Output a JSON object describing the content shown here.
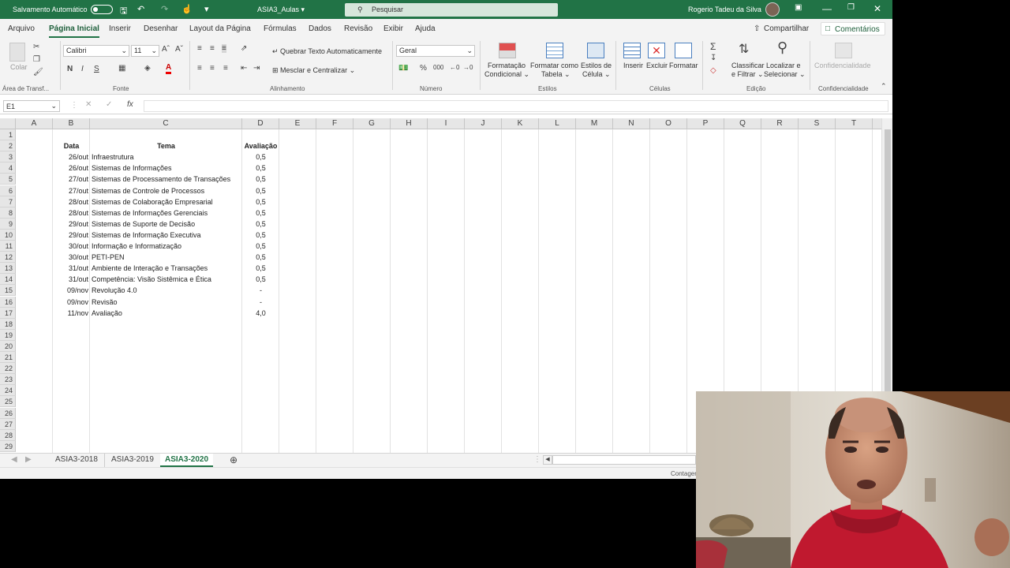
{
  "titlebar": {
    "autosave": "Salvamento Automático",
    "filename": "ASIA3_Aulas",
    "search_placeholder": "Pesquisar",
    "user": "Rogerio Tadeu da Silva"
  },
  "menu": {
    "tabs": [
      "Arquivo",
      "Página Inicial",
      "Inserir",
      "Desenhar",
      "Layout da Página",
      "Fórmulas",
      "Dados",
      "Revisão",
      "Exibir",
      "Ajuda"
    ],
    "share": "Compartilhar",
    "comments": "Comentários"
  },
  "ribbon": {
    "paste": "Colar",
    "font_name": "Calibri",
    "font_size": "11",
    "wrap_text": "Quebrar Texto Automaticamente",
    "merge_center": "Mesclar e Centralizar",
    "number_format": "Geral",
    "cond_format": [
      "Formatação",
      "Condicional"
    ],
    "format_table": [
      "Formatar como",
      "Tabela"
    ],
    "cell_styles": [
      "Estilos de",
      "Célula"
    ],
    "insert": "Inserir",
    "delete": "Excluir",
    "format": "Formatar",
    "sort_filter": [
      "Classificar",
      "e Filtrar"
    ],
    "find_select": [
      "Localizar e",
      "Selecionar"
    ],
    "confidentiality": "Confidencialidade",
    "bold": "N",
    "italic": "I",
    "underline": "S",
    "groups": {
      "clipboard": "Área de Transf...",
      "font": "Fonte",
      "alignment": "Alinhamento",
      "number": "Número",
      "styles": "Estilos",
      "cells": "Células",
      "editing": "Edição",
      "confidentiality": "Confidencialidade"
    }
  },
  "formula_bar": {
    "name_box": "E1",
    "fx": "fx",
    "content": ""
  },
  "sheet": {
    "columns": [
      "A",
      "B",
      "C",
      "D",
      "E",
      "F",
      "G",
      "H",
      "I",
      "J",
      "K",
      "L",
      "M",
      "N",
      "O",
      "P",
      "Q",
      "R",
      "S",
      "T",
      "U"
    ],
    "row_numbers": [
      "1",
      "2",
      "3",
      "4",
      "5",
      "6",
      "7",
      "8",
      "9",
      "10",
      "11",
      "12",
      "13",
      "14",
      "15",
      "16",
      "17",
      "18",
      "19",
      "20",
      "21",
      "22",
      "23",
      "24",
      "25",
      "26",
      "27",
      "28",
      "29"
    ],
    "headers": {
      "date": "Data",
      "topic": "Tema",
      "grade": "Avaliação"
    },
    "rows": [
      {
        "date": "26/out",
        "topic": "Infraestrutura",
        "grade": "0,5"
      },
      {
        "date": "26/out",
        "topic": "Sistemas de Informações",
        "grade": "0,5"
      },
      {
        "date": "27/out",
        "topic": "Sistemas de Processamento de Transações",
        "grade": "0,5"
      },
      {
        "date": "27/out",
        "topic": "Sistemas de Controle de Processos",
        "grade": "0,5"
      },
      {
        "date": "28/out",
        "topic": "Sistemas de Colaboração Empresarial",
        "grade": "0,5"
      },
      {
        "date": "28/out",
        "topic": "Sistemas de Informações Gerenciais",
        "grade": "0,5"
      },
      {
        "date": "29/out",
        "topic": "Sistemas de Suporte de Decisão",
        "grade": "0,5"
      },
      {
        "date": "29/out",
        "topic": "Sistemas de Informação Executiva",
        "grade": "0,5"
      },
      {
        "date": "30/out",
        "topic": "Informação e Informatização",
        "grade": "0,5"
      },
      {
        "date": "30/out",
        "topic": "PETI-PEN",
        "grade": "0,5"
      },
      {
        "date": "31/out",
        "topic": "Ambiente de Interação e Transações",
        "grade": "0,5"
      },
      {
        "date": "31/out",
        "topic": "Competência: Visão Sistêmica e Ética",
        "grade": "0,5"
      },
      {
        "date": "09/nov",
        "topic": "Revolução 4.0",
        "grade": "-"
      },
      {
        "date": "09/nov",
        "topic": "Revisão",
        "grade": "-"
      },
      {
        "date": "11/nov",
        "topic": "Avaliação",
        "grade": "4,0"
      }
    ]
  },
  "sheet_tabs": [
    "ASIA3-2018",
    "ASIA3-2019",
    "ASIA3-2020"
  ],
  "active_sheet": "ASIA3-2020",
  "status": {
    "text": "Contagem"
  },
  "colors": {
    "accent": "#217346"
  }
}
